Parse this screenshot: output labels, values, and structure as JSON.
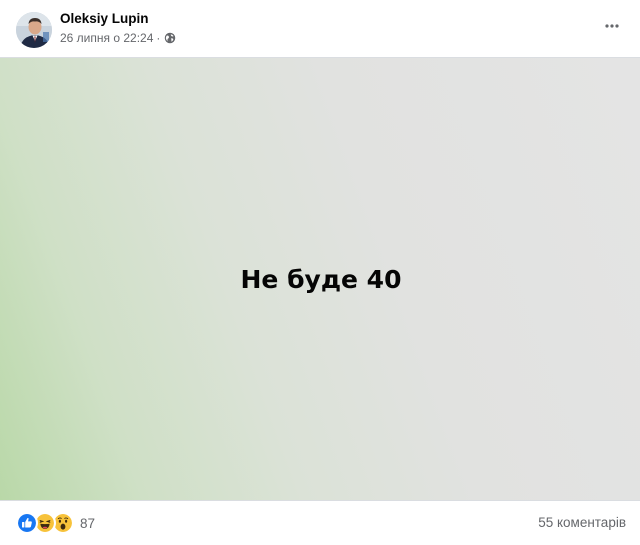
{
  "post": {
    "author_name": "Oleksiy Lupin",
    "date": "26 липня о 22:24",
    "date_separator": "·",
    "privacy_icon": "globe-icon",
    "more_icon": "more-options-icon",
    "image_text": "Не буде 40"
  },
  "reactions": {
    "icons": [
      "like-icon",
      "haha-icon",
      "wow-icon"
    ],
    "count": "87"
  },
  "comments": {
    "label": "55 коментарів"
  },
  "colors": {
    "like_blue": "#1877f2",
    "emoji_yellow": "#f7c23a",
    "secondary_text": "#65676b",
    "primary_text": "#050505"
  }
}
